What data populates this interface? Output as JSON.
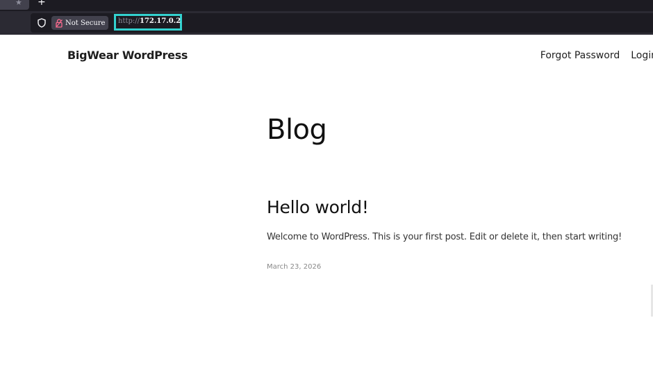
{
  "browser": {
    "tab_icon": "star-icon",
    "new_tab_label": "+",
    "security_label": "Not Secure",
    "url_scheme": "http://",
    "url_host": "172.17.0.2"
  },
  "site": {
    "title": "BigWear WordPress",
    "nav": [
      "Forgot Password",
      "Login"
    ]
  },
  "page": {
    "title": "Blog"
  },
  "post": {
    "title": "Hello world!",
    "excerpt": "Welcome to WordPress. This is your first post. Edit or delete it, then start writing!",
    "date": "March 23, 2026"
  },
  "colors": {
    "highlight": "#33d1cf",
    "chrome_bg": "#2b2a33",
    "urlbar_bg": "#1c1b22"
  }
}
